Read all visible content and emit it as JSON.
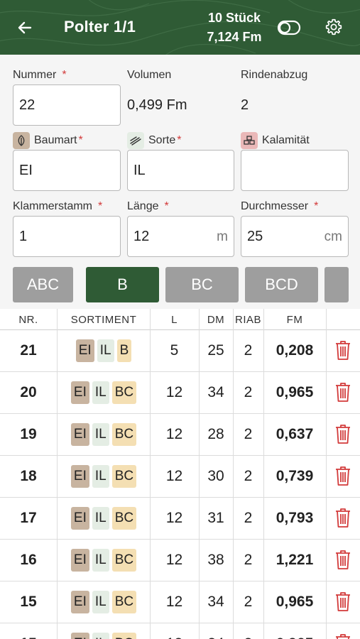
{
  "header": {
    "title": "Polter 1/1",
    "count": "10 Stück",
    "volume": "7,124 Fm",
    "icons": [
      "back-arrow-icon",
      "toggle-icon",
      "gear-icon"
    ]
  },
  "form": {
    "nummer": {
      "label": "Nummer",
      "required": "*",
      "value": "22"
    },
    "volumen": {
      "label": "Volumen",
      "value": "0,499 Fm"
    },
    "rindenabzug": {
      "label": "Rindenabzug",
      "value": "2"
    },
    "baumart": {
      "label": "Baumart",
      "required": "*",
      "value": "EI",
      "icon": "leaf-icon"
    },
    "sorte": {
      "label": "Sorte",
      "required": "*",
      "value": "IL",
      "icon": "log-icon"
    },
    "kalamitaet": {
      "label": "Kalamität",
      "value": "",
      "icon": "logs-pile-icon"
    },
    "klammerstamm": {
      "label": "Klammerstamm",
      "required": "*",
      "value": "1"
    },
    "laenge": {
      "label": "Länge",
      "required": "*",
      "value": "12",
      "unit": "m"
    },
    "durchmesser": {
      "label": "Durchmesser",
      "required": "*",
      "value": "25",
      "unit": "cm"
    }
  },
  "chips": [
    "ABC",
    "B",
    "BC",
    "BCD"
  ],
  "chips_active": "B",
  "table": {
    "headers": [
      "NR.",
      "SORTIMENT",
      "L",
      "DM",
      "RIAB",
      "FM"
    ],
    "rows": [
      {
        "nr": "21",
        "tags": [
          "EI",
          "IL",
          "B"
        ],
        "l": "5",
        "dm": "25",
        "riab": "2",
        "fm": "0,208"
      },
      {
        "nr": "20",
        "tags": [
          "EI",
          "IL",
          "BC"
        ],
        "l": "12",
        "dm": "34",
        "riab": "2",
        "fm": "0,965"
      },
      {
        "nr": "19",
        "tags": [
          "EI",
          "IL",
          "BC"
        ],
        "l": "12",
        "dm": "28",
        "riab": "2",
        "fm": "0,637"
      },
      {
        "nr": "18",
        "tags": [
          "EI",
          "IL",
          "BC"
        ],
        "l": "12",
        "dm": "30",
        "riab": "2",
        "fm": "0,739"
      },
      {
        "nr": "17",
        "tags": [
          "EI",
          "IL",
          "BC"
        ],
        "l": "12",
        "dm": "31",
        "riab": "2",
        "fm": "0,793"
      },
      {
        "nr": "16",
        "tags": [
          "EI",
          "IL",
          "BC"
        ],
        "l": "12",
        "dm": "38",
        "riab": "2",
        "fm": "1,221"
      },
      {
        "nr": "15",
        "tags": [
          "EI",
          "IL",
          "BC"
        ],
        "l": "12",
        "dm": "34",
        "riab": "2",
        "fm": "0,965"
      }
    ]
  },
  "colors": {
    "header_bg": "#2f5b35",
    "active_chip": "#2f5b35",
    "inactive_chip": "#9e9e9e",
    "required": "#d23a3a",
    "delete": "#d23a3a",
    "tag_ei": "#c8b4a0",
    "tag_il": "#e4ede4",
    "tag_sortiment": "#f4dfb3"
  }
}
